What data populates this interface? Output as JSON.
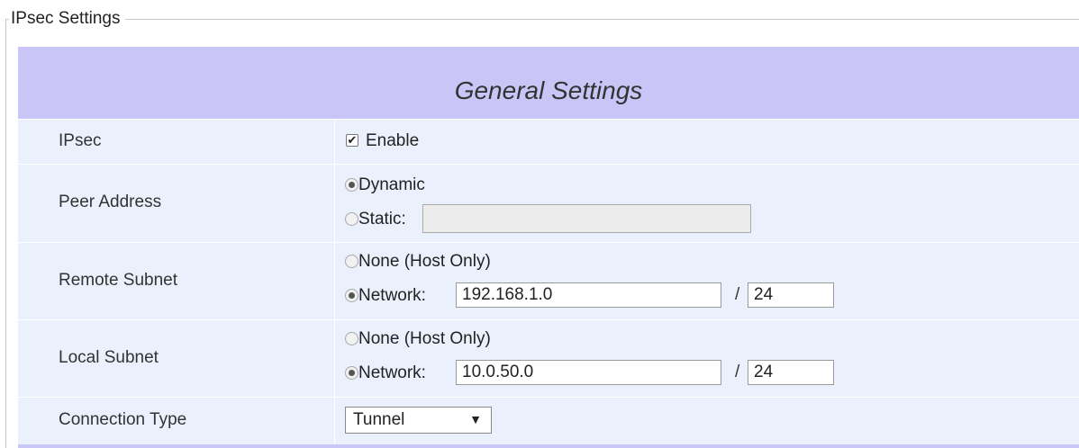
{
  "fieldset": {
    "legend": "IPsec Settings"
  },
  "header": {
    "title": "General Settings"
  },
  "rows": {
    "ipsec": {
      "label": "IPsec",
      "checkbox_label": "Enable",
      "checked": true
    },
    "peer_address": {
      "label": "Peer Address",
      "option_dynamic": "Dynamic",
      "option_static": "Static:",
      "selected": "Dynamic",
      "static_value": ""
    },
    "remote_subnet": {
      "label": "Remote Subnet",
      "option_none": "None (Host Only)",
      "option_network": "Network:",
      "selected": "Network:",
      "network_value": "192.168.1.0",
      "slash": "/",
      "prefix_value": "24"
    },
    "local_subnet": {
      "label": "Local Subnet",
      "option_none": "None (Host Only)",
      "option_network": "Network:",
      "selected": "Network:",
      "network_value": "10.0.50.0",
      "slash": "/",
      "prefix_value": "24"
    },
    "connection_type": {
      "label": "Connection Type",
      "value": "Tunnel",
      "arrow": "▼"
    }
  },
  "colors": {
    "header_bg": "#c9c6f7",
    "row_bg": "#eaf1fd",
    "fieldset_border": "#c9c9c9"
  }
}
